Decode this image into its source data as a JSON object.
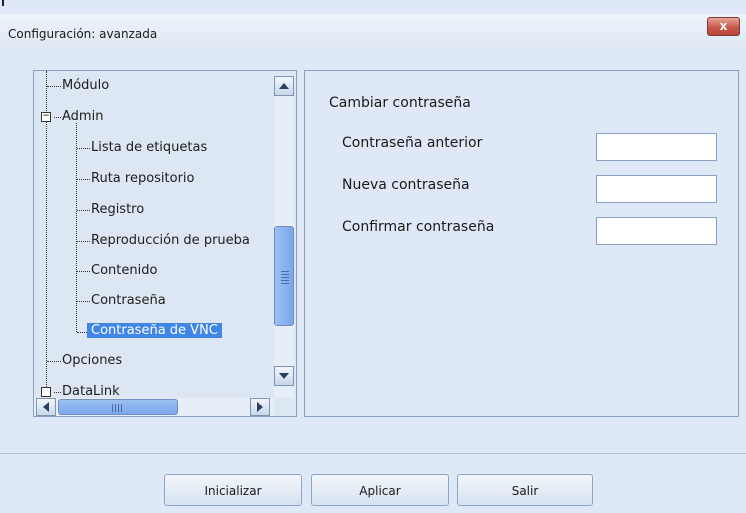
{
  "window": {
    "title": "Configuración: avanzada",
    "close_label": "x"
  },
  "tree": {
    "items": [
      {
        "label": "Módulo",
        "level": 1
      },
      {
        "label": "Admin",
        "level": 1,
        "expanded": true
      },
      {
        "label": "Lista de etiquetas",
        "level": 2
      },
      {
        "label": "Ruta repositorio",
        "level": 2
      },
      {
        "label": "Registro",
        "level": 2
      },
      {
        "label": "Reproducción de prueba",
        "level": 2
      },
      {
        "label": "Contenido",
        "level": 2
      },
      {
        "label": "Contraseña",
        "level": 2
      },
      {
        "label": "Contraseña de VNC",
        "level": 2,
        "selected": true
      },
      {
        "label": "Opciones",
        "level": 1
      },
      {
        "label": "DataLink",
        "level": 1,
        "partially_visible": true
      }
    ],
    "expander_minus": "−"
  },
  "content": {
    "section_title": "Cambiar contraseña",
    "fields": [
      {
        "label": "Contraseña anterior",
        "value": ""
      },
      {
        "label": "Nueva contraseña",
        "value": ""
      },
      {
        "label": "Confirmar contraseña",
        "value": ""
      }
    ]
  },
  "buttons": {
    "initialize": "Inicializar",
    "apply": "Aplicar",
    "exit": "Salir"
  },
  "colors": {
    "background": "#dfe8f6",
    "selection": "#3f86e6",
    "close_button": "#c8584a"
  }
}
